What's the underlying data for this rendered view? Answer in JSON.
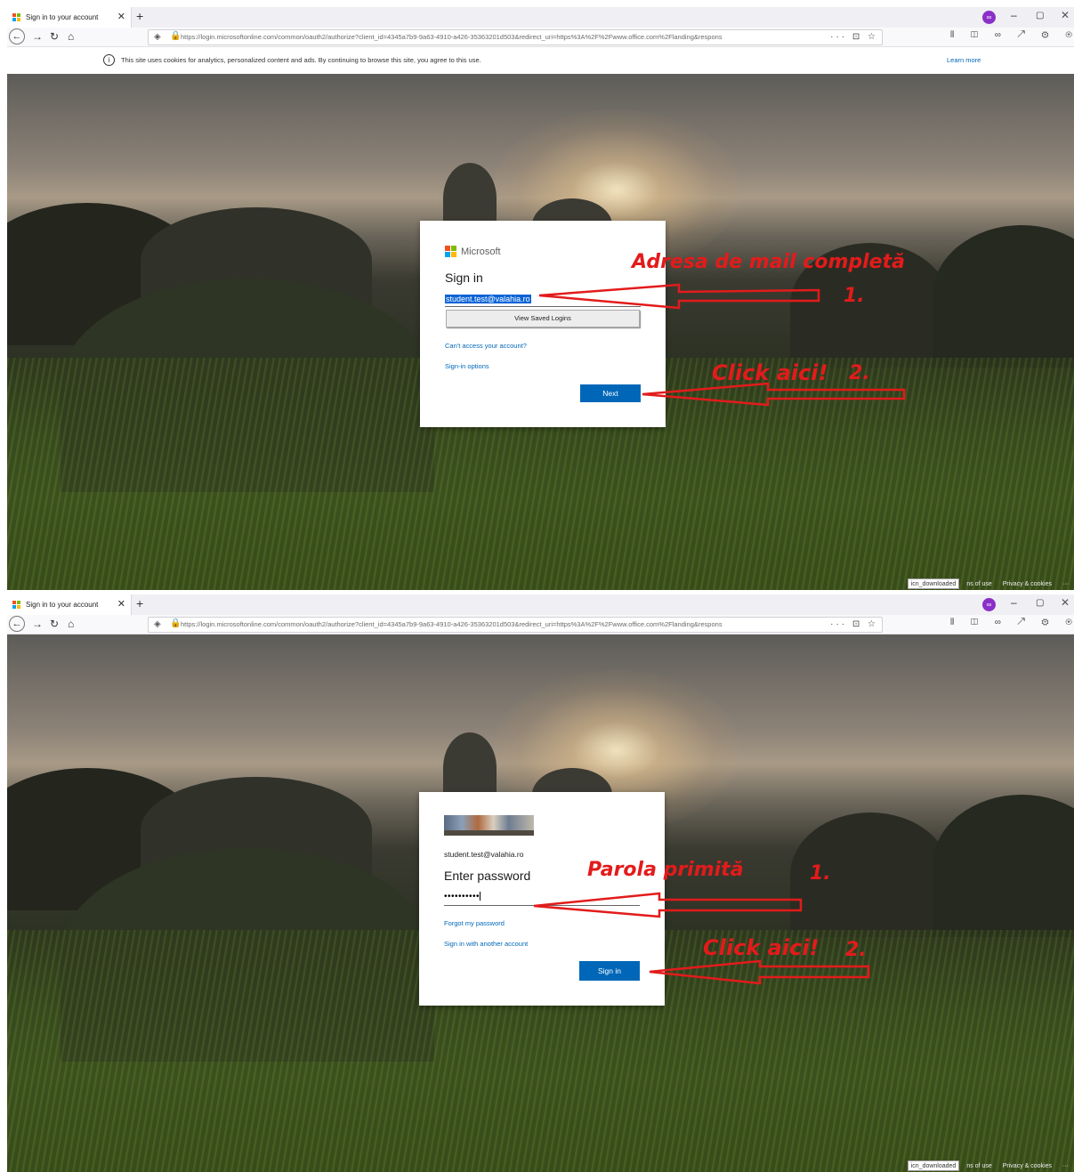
{
  "screens": [
    {
      "tab": {
        "title": "Sign in to your account",
        "close": "✕",
        "new": "+"
      },
      "window": {
        "ext": "∞",
        "min": "–",
        "max": "▢",
        "close": "✕"
      },
      "nav": {
        "back": "←",
        "forward": "→",
        "reload": "↻",
        "home": "⌂",
        "shield": "◈",
        "lock": "🔒",
        "url": "https://login.microsoftonline.com/common/oauth2/authorize?client_id=4345a7b9-9a63-4910-a426-35363201d503&redirect_uri=https%3A%2F%2Fwww.office.com%2Flanding&respons",
        "actions": "··· ⊡ ☆",
        "toolbar": "⫴ ◫ ∞ ↗ ⚙ ⊛ ≡"
      },
      "cookie": {
        "text": "This site uses cookies for analytics, personalized content and ads. By continuing to browse this site, you agree to this use.",
        "learn_more": "Learn more"
      },
      "card": {
        "brand": "Microsoft",
        "title": "Sign in",
        "email_value": "student.test@valahia.ro",
        "saved_logins": "View Saved Logins",
        "cant_access": "Can't access your account?",
        "signin_options": "Sign-in options",
        "next": "Next"
      },
      "annotations": {
        "label1": "Adresa de mail completă",
        "num1": "1.",
        "label2": "Click aici!",
        "num2": "2."
      },
      "footer": {
        "chip": "icn_downloaded",
        "terms": "ns of use",
        "privacy": "Privacy & cookies",
        "more": "···"
      }
    },
    {
      "tab": {
        "title": "Sign in to your account",
        "close": "✕",
        "new": "+"
      },
      "window": {
        "ext": "∞",
        "min": "–",
        "max": "▢",
        "close": "✕"
      },
      "nav": {
        "back": "←",
        "forward": "→",
        "reload": "↻",
        "home": "⌂",
        "shield": "◈",
        "lock": "🔒",
        "url": "https://login.microsoftonline.com/common/oauth2/authorize?client_id=4345a7b9-9a63-4910-a426-35363201d503&redirect_uri=https%3A%2F%2Fwww.office.com%2Flanding&respons",
        "actions": "··· ⊡ ☆",
        "toolbar": "⫴ ◫ ∞ ↗ ⚙ ⊛ ≡"
      },
      "card": {
        "user_email": "student.test@valahia.ro",
        "title": "Enter password",
        "password_value": "••••••••••",
        "forgot": "Forgot my password",
        "another": "Sign in with another account",
        "signin": "Sign in"
      },
      "annotations": {
        "label1": "Parola primită",
        "num1": "1.",
        "label2": "Click aici!",
        "num2": "2."
      },
      "footer": {
        "chip": "icn_downloaded",
        "terms": "ns of use",
        "privacy": "Privacy & cookies",
        "more": "···"
      }
    }
  ],
  "colors": {
    "accent": "#0067b8",
    "annotation": "#e31b1b",
    "ms_red": "#f25022",
    "ms_green": "#7fba00",
    "ms_blue": "#00a4ef",
    "ms_yellow": "#ffb900"
  }
}
